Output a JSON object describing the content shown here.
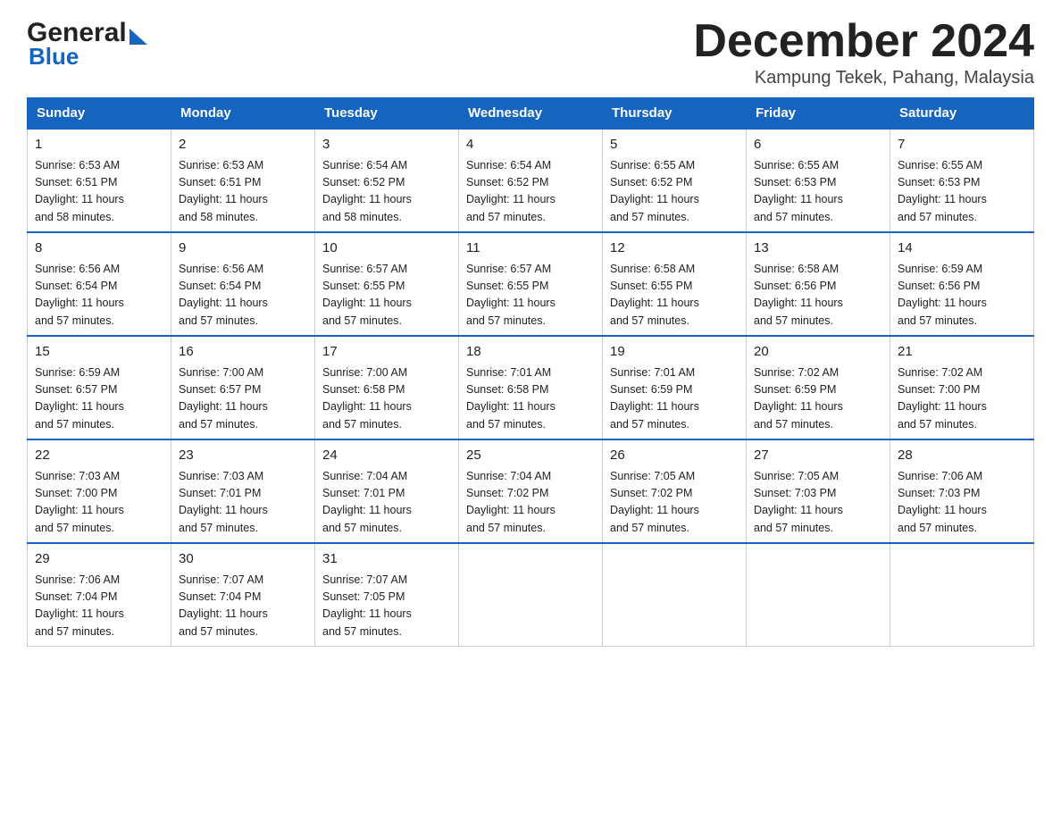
{
  "header": {
    "logo_text1": "General",
    "logo_text2": "Blue",
    "month_title": "December 2024",
    "location": "Kampung Tekek, Pahang, Malaysia"
  },
  "days_of_week": [
    "Sunday",
    "Monday",
    "Tuesday",
    "Wednesday",
    "Thursday",
    "Friday",
    "Saturday"
  ],
  "weeks": [
    [
      {
        "day": "1",
        "sunrise": "6:53 AM",
        "sunset": "6:51 PM",
        "daylight": "11 hours and 58 minutes."
      },
      {
        "day": "2",
        "sunrise": "6:53 AM",
        "sunset": "6:51 PM",
        "daylight": "11 hours and 58 minutes."
      },
      {
        "day": "3",
        "sunrise": "6:54 AM",
        "sunset": "6:52 PM",
        "daylight": "11 hours and 58 minutes."
      },
      {
        "day": "4",
        "sunrise": "6:54 AM",
        "sunset": "6:52 PM",
        "daylight": "11 hours and 57 minutes."
      },
      {
        "day": "5",
        "sunrise": "6:55 AM",
        "sunset": "6:52 PM",
        "daylight": "11 hours and 57 minutes."
      },
      {
        "day": "6",
        "sunrise": "6:55 AM",
        "sunset": "6:53 PM",
        "daylight": "11 hours and 57 minutes."
      },
      {
        "day": "7",
        "sunrise": "6:55 AM",
        "sunset": "6:53 PM",
        "daylight": "11 hours and 57 minutes."
      }
    ],
    [
      {
        "day": "8",
        "sunrise": "6:56 AM",
        "sunset": "6:54 PM",
        "daylight": "11 hours and 57 minutes."
      },
      {
        "day": "9",
        "sunrise": "6:56 AM",
        "sunset": "6:54 PM",
        "daylight": "11 hours and 57 minutes."
      },
      {
        "day": "10",
        "sunrise": "6:57 AM",
        "sunset": "6:55 PM",
        "daylight": "11 hours and 57 minutes."
      },
      {
        "day": "11",
        "sunrise": "6:57 AM",
        "sunset": "6:55 PM",
        "daylight": "11 hours and 57 minutes."
      },
      {
        "day": "12",
        "sunrise": "6:58 AM",
        "sunset": "6:55 PM",
        "daylight": "11 hours and 57 minutes."
      },
      {
        "day": "13",
        "sunrise": "6:58 AM",
        "sunset": "6:56 PM",
        "daylight": "11 hours and 57 minutes."
      },
      {
        "day": "14",
        "sunrise": "6:59 AM",
        "sunset": "6:56 PM",
        "daylight": "11 hours and 57 minutes."
      }
    ],
    [
      {
        "day": "15",
        "sunrise": "6:59 AM",
        "sunset": "6:57 PM",
        "daylight": "11 hours and 57 minutes."
      },
      {
        "day": "16",
        "sunrise": "7:00 AM",
        "sunset": "6:57 PM",
        "daylight": "11 hours and 57 minutes."
      },
      {
        "day": "17",
        "sunrise": "7:00 AM",
        "sunset": "6:58 PM",
        "daylight": "11 hours and 57 minutes."
      },
      {
        "day": "18",
        "sunrise": "7:01 AM",
        "sunset": "6:58 PM",
        "daylight": "11 hours and 57 minutes."
      },
      {
        "day": "19",
        "sunrise": "7:01 AM",
        "sunset": "6:59 PM",
        "daylight": "11 hours and 57 minutes."
      },
      {
        "day": "20",
        "sunrise": "7:02 AM",
        "sunset": "6:59 PM",
        "daylight": "11 hours and 57 minutes."
      },
      {
        "day": "21",
        "sunrise": "7:02 AM",
        "sunset": "7:00 PM",
        "daylight": "11 hours and 57 minutes."
      }
    ],
    [
      {
        "day": "22",
        "sunrise": "7:03 AM",
        "sunset": "7:00 PM",
        "daylight": "11 hours and 57 minutes."
      },
      {
        "day": "23",
        "sunrise": "7:03 AM",
        "sunset": "7:01 PM",
        "daylight": "11 hours and 57 minutes."
      },
      {
        "day": "24",
        "sunrise": "7:04 AM",
        "sunset": "7:01 PM",
        "daylight": "11 hours and 57 minutes."
      },
      {
        "day": "25",
        "sunrise": "7:04 AM",
        "sunset": "7:02 PM",
        "daylight": "11 hours and 57 minutes."
      },
      {
        "day": "26",
        "sunrise": "7:05 AM",
        "sunset": "7:02 PM",
        "daylight": "11 hours and 57 minutes."
      },
      {
        "day": "27",
        "sunrise": "7:05 AM",
        "sunset": "7:03 PM",
        "daylight": "11 hours and 57 minutes."
      },
      {
        "day": "28",
        "sunrise": "7:06 AM",
        "sunset": "7:03 PM",
        "daylight": "11 hours and 57 minutes."
      }
    ],
    [
      {
        "day": "29",
        "sunrise": "7:06 AM",
        "sunset": "7:04 PM",
        "daylight": "11 hours and 57 minutes."
      },
      {
        "day": "30",
        "sunrise": "7:07 AM",
        "sunset": "7:04 PM",
        "daylight": "11 hours and 57 minutes."
      },
      {
        "day": "31",
        "sunrise": "7:07 AM",
        "sunset": "7:05 PM",
        "daylight": "11 hours and 57 minutes."
      },
      null,
      null,
      null,
      null
    ]
  ],
  "labels": {
    "sunrise_prefix": "Sunrise: ",
    "sunset_prefix": "Sunset: ",
    "daylight_prefix": "Daylight: "
  },
  "colors": {
    "header_bg": "#1565C0",
    "header_text": "#ffffff",
    "border": "#aaaaaa",
    "accent_border": "#1565C0"
  }
}
